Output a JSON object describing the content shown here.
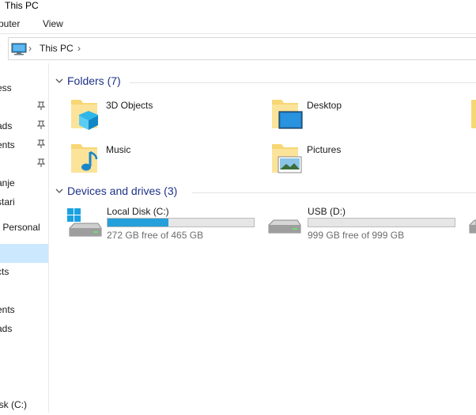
{
  "window": {
    "title": "This PC"
  },
  "ribbon": {
    "tabs": [
      "puter",
      "View"
    ]
  },
  "address": {
    "crumb": "This PC"
  },
  "nav": {
    "items": [
      {
        "label": "ess",
        "pinned": false
      },
      {
        "label": "",
        "pinned": true
      },
      {
        "label": "ads",
        "pinned": true
      },
      {
        "label": "ents",
        "pinned": true
      },
      {
        "label": "",
        "pinned": true
      },
      {
        "label": "anje",
        "pinned": false
      },
      {
        "label": "stari",
        "pinned": false
      },
      {
        "label": "- Personal",
        "pinned": false
      },
      {
        "label": "",
        "pinned": false,
        "selected": true
      },
      {
        "label": "cts",
        "pinned": false
      },
      {
        "label": "",
        "pinned": false
      },
      {
        "label": "ents",
        "pinned": false
      },
      {
        "label": "ads",
        "pinned": false
      },
      {
        "label": "isk (C:)",
        "pinned": false
      }
    ]
  },
  "folders_group": {
    "title": "Folders (7)",
    "items": [
      {
        "name": "3D Objects",
        "icon": "3d-objects-folder-icon"
      },
      {
        "name": "Desktop",
        "icon": "desktop-folder-icon"
      },
      {
        "name": "Music",
        "icon": "music-folder-icon"
      },
      {
        "name": "Pictures",
        "icon": "pictures-folder-icon"
      }
    ]
  },
  "drives_group": {
    "title": "Devices and drives (3)",
    "items": [
      {
        "name": "Local Disk (C:)",
        "free_text": "272 GB free of 465 GB",
        "used_fraction": 0.415,
        "icon": "windows-drive-icon"
      },
      {
        "name": "USB (D:)",
        "free_text": "999 GB free of 999 GB",
        "used_fraction": 0.0,
        "icon": "usb-drive-icon"
      }
    ]
  },
  "colors": {
    "accent": "#26a0da",
    "header_text": "#1e3287",
    "selection": "#cce8ff"
  }
}
